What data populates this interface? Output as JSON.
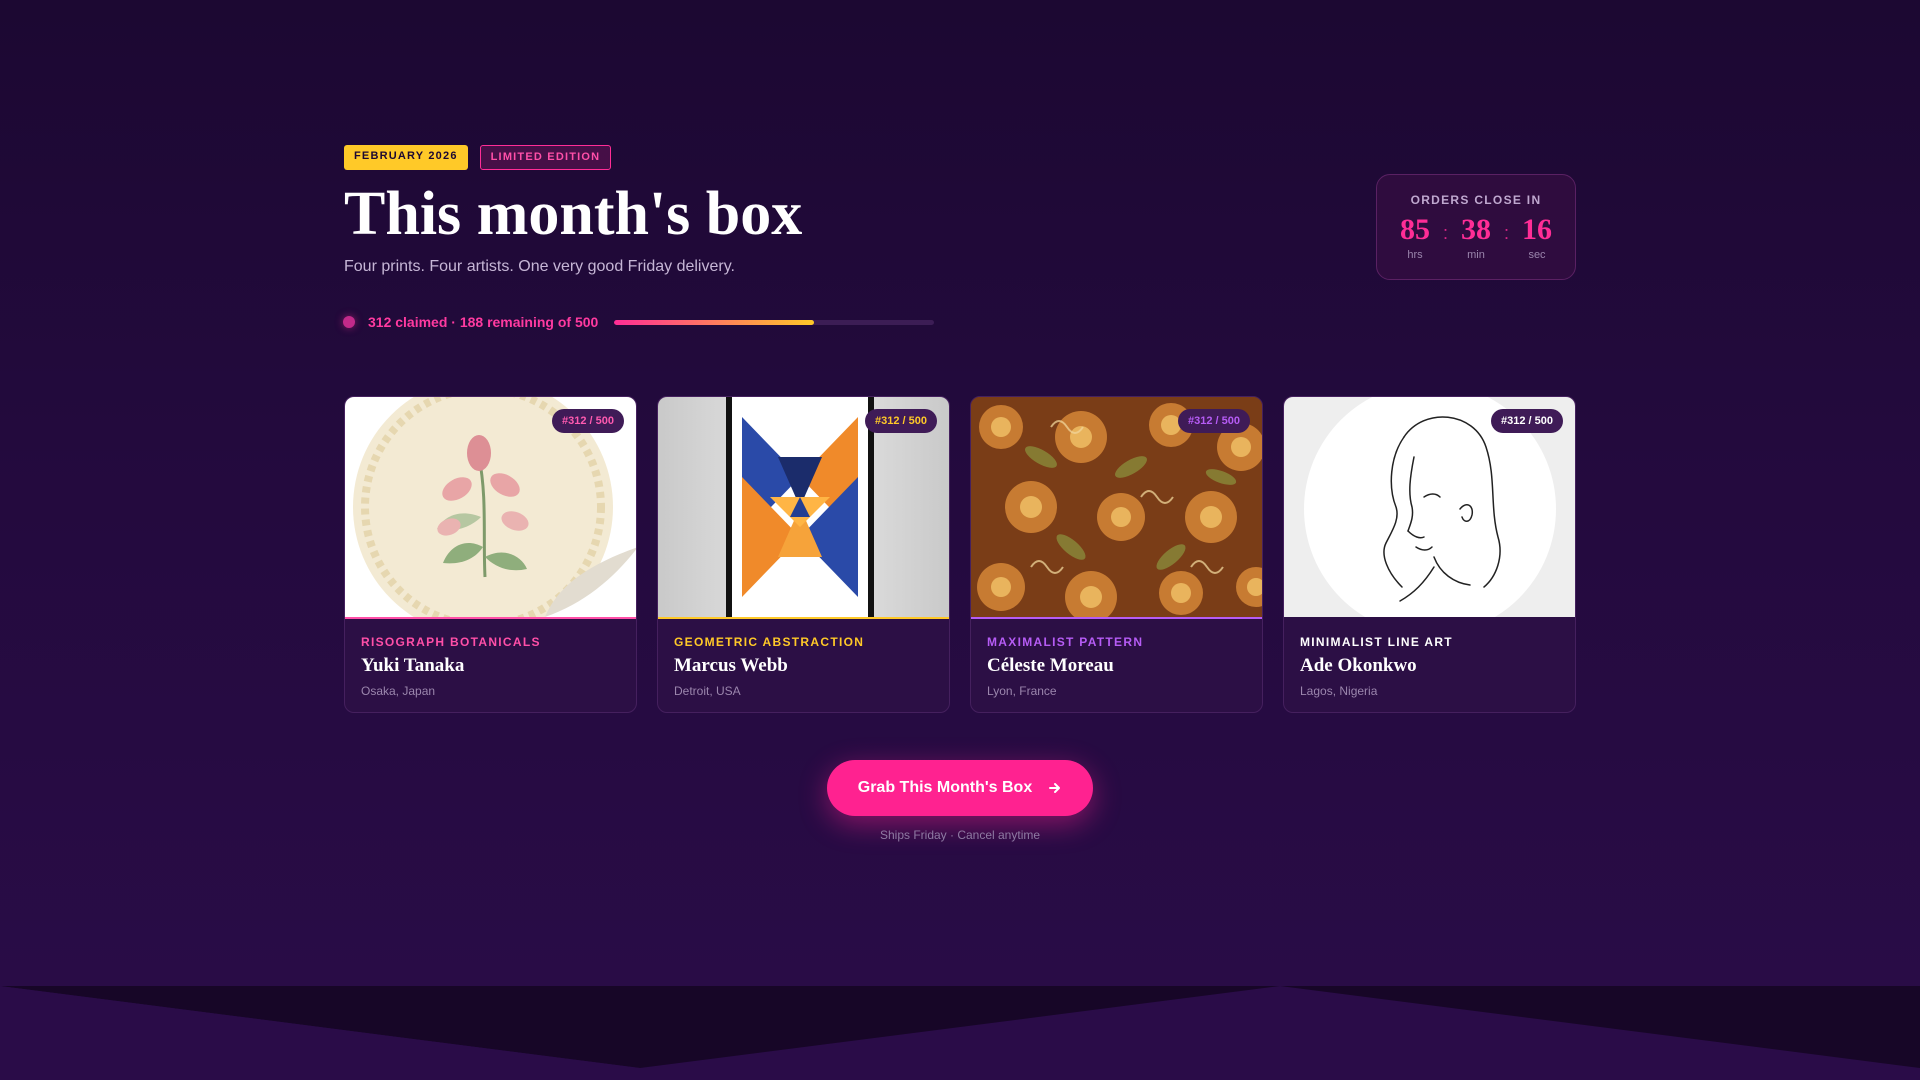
{
  "header": {
    "date_badge": "FEBRUARY 2026",
    "edition_badge": "LIMITED EDITION",
    "title": "This month's box",
    "subtitle": "Four prints. Four artists. One very good Friday delivery."
  },
  "progress": {
    "text": "312 claimed · 188 remaining of 500",
    "claimed": 312,
    "total": 500,
    "fraction": 0.624
  },
  "countdown": {
    "label": "ORDERS CLOSE IN",
    "hours": "85",
    "hours_label": "hrs",
    "minutes": "38",
    "minutes_label": "min",
    "seconds": "16",
    "seconds_label": "sec",
    "separator": ":"
  },
  "cards": [
    {
      "edition": "#312 / 500",
      "style": "RISOGRAPH BOTANICALS",
      "artist": "Yuki Tanaka",
      "location": "Osaka, Japan",
      "accent": "#ff4fa8",
      "image": "botanical-print-image"
    },
    {
      "edition": "#312 / 500",
      "style": "GEOMETRIC ABSTRACTION",
      "artist": "Marcus Webb",
      "location": "Detroit, USA",
      "accent": "#ffc928",
      "image": "geometric-print-image"
    },
    {
      "edition": "#312 / 500",
      "style": "MAXIMALIST PATTERN",
      "artist": "Céleste Moreau",
      "location": "Lyon, France",
      "accent": "#b65cf5",
      "image": "pattern-print-image"
    },
    {
      "edition": "#312 / 500",
      "style": "MINIMALIST LINE ART",
      "artist": "Ade Okonkwo",
      "location": "Lagos, Nigeria",
      "accent": "#ffffff",
      "image": "line-art-print-image"
    }
  ],
  "cta": {
    "label": "Grab This Month's Box",
    "icon": "arrow-right-icon",
    "note": "Ships Friday · Cancel anytime"
  },
  "colors": {
    "background": "#230a3d",
    "primary": "#ff2290",
    "gold": "#ffc928",
    "purple": "#b65cf5"
  }
}
